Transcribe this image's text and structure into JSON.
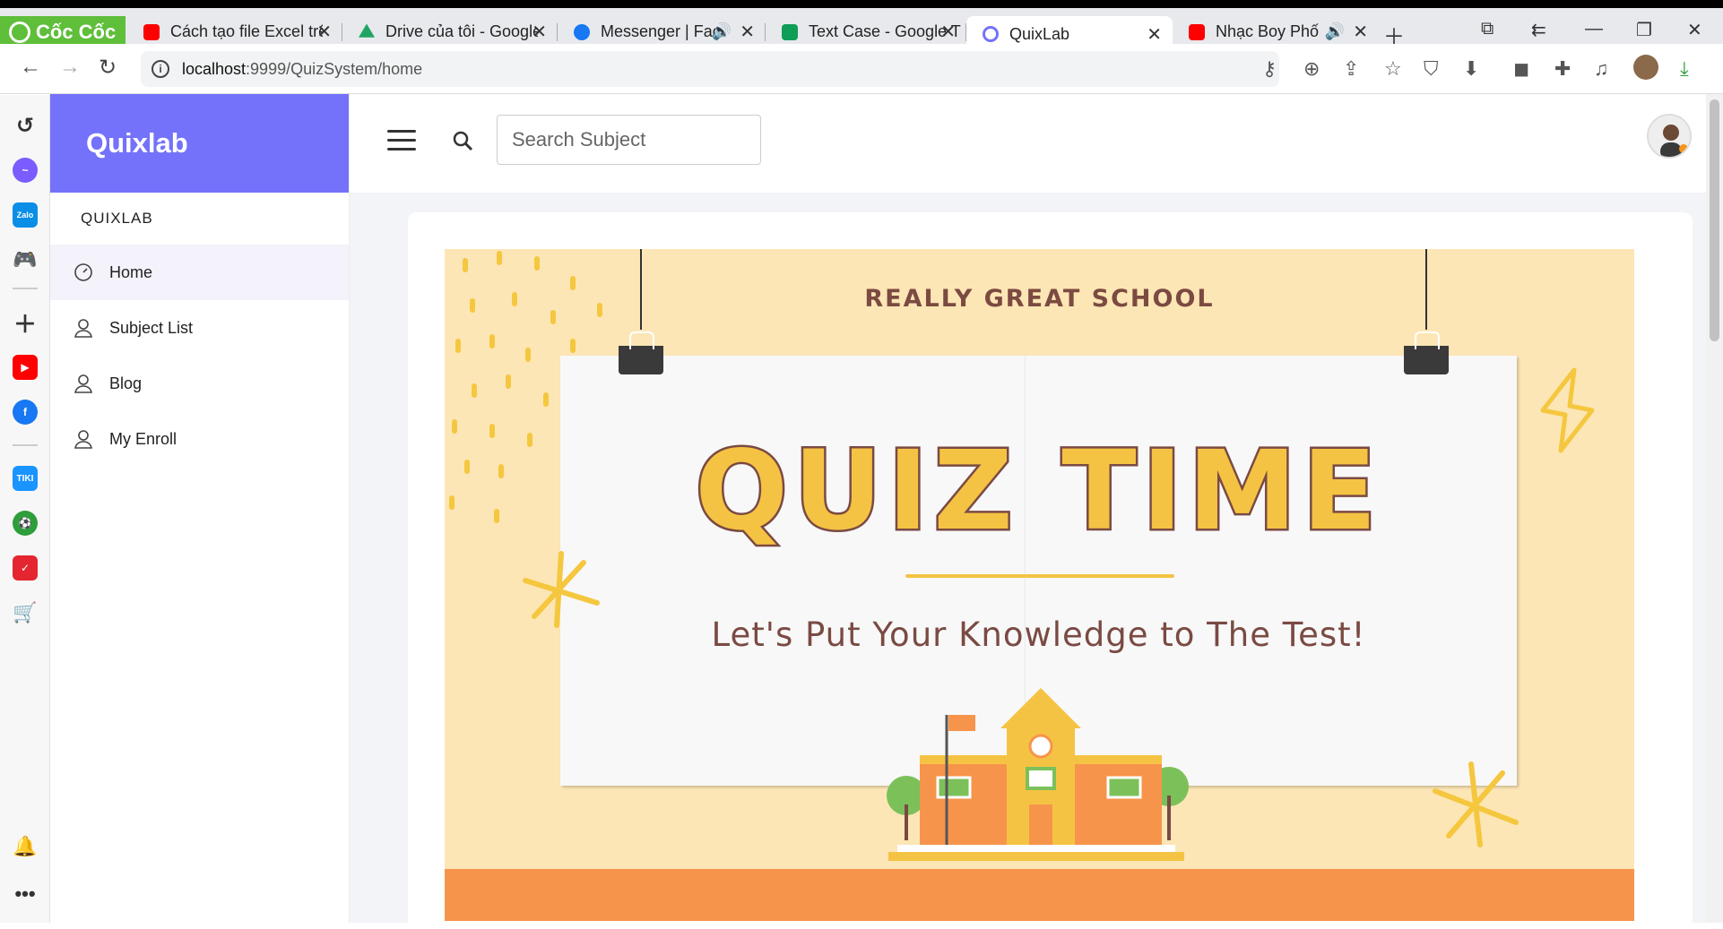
{
  "browser": {
    "brand_label": "Cốc Cốc",
    "tabs": [
      {
        "title": "Cách tạo file Excel trên",
        "favicon": "youtube-icon",
        "color": "#ff0000"
      },
      {
        "title": "Drive của tôi - Google",
        "favicon": "google-drive-icon",
        "color": "#1fa463"
      },
      {
        "title": "Messenger | Facebook",
        "favicon": "facebook-icon",
        "color": "#1877f2"
      },
      {
        "title": "Text Case - Google Trang",
        "favicon": "google-sheets-icon",
        "color": "#0f9d58"
      },
      {
        "title": "QuixLab",
        "favicon": "quixlab-icon",
        "color": "#7472fa"
      },
      {
        "title": "Nhạc Boy Phố -",
        "favicon": "youtube-icon",
        "color": "#ff0000"
      }
    ],
    "url_host": "localhost",
    "url_path": ":9999/QuizSystem/home"
  },
  "app": {
    "brand": "Quixlab",
    "section_label": "QUIXLAB",
    "nav": [
      {
        "label": "Home"
      },
      {
        "label": "Subject List"
      },
      {
        "label": "Blog"
      },
      {
        "label": "My Enroll"
      }
    ],
    "search_placeholder": "Search Subject"
  },
  "banner": {
    "school": "REALLY GREAT SCHOOL",
    "headline": "QUIZ TIME",
    "tagline": "Let's Put Your Knowledge to The Test!"
  },
  "colors": {
    "accent": "#7472fa",
    "banner_bg": "#fde6b5",
    "headline_fill": "#f5c343",
    "headline_stroke": "#7a4a43",
    "floor": "#f7944b"
  }
}
